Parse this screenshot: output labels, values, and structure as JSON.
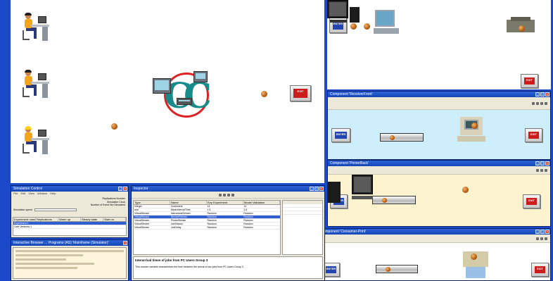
{
  "buttons": {
    "exit": "EXIT",
    "enter": "ENTER"
  },
  "windows": {
    "sub1_title": "Component 'ReceiverFront'",
    "sub2_title": "Component 'PrinterBack'",
    "sub3_title": "Component 'Consumer-Print'",
    "sim_control_title": "Simulation Control",
    "sim_console_title": "Interactive Browser ... Programs (AS) 'Mainframe (Simulator)'",
    "inspect_title": "Inspector"
  },
  "sim_control": {
    "menu": [
      "File",
      "Edit",
      "View",
      "Window",
      "Help"
    ],
    "fields": [
      "Replications Number",
      "Simulation Clock",
      "Number of Event Not Simulated"
    ],
    "animation_speed_label": "Simulation speed",
    "grid_headers": [
      "Experiment name",
      "Replications",
      "Warm up",
      "Steady state",
      "Start on"
    ],
    "grid_rows": [
      "Experiment 1",
      "Cafe Ventures 1"
    ]
  },
  "inspector": {
    "headers": [
      "Type",
      "Name",
      "Key Experiment",
      "Model Validation"
    ],
    "rows": [
      [
        "Integer",
        "Customers",
        "14",
        "14"
      ],
      [
        "real",
        "MeanIntervalTime",
        "1.5",
        "1.5"
      ],
      [
        "VirtualStream",
        "InterarrivalStream",
        "Random",
        "Random"
      ],
      [
        "VirtualStream",
        "ServiceStream",
        "Random",
        "Random"
      ],
      [
        "VirtualStream",
        "PrinterStream",
        "Random",
        "Random"
      ],
      [
        "VirtualStream",
        "JobStream",
        "Random",
        "Random"
      ],
      [
        "VirtualStream",
        "JobDelay",
        "Random",
        "Random"
      ]
    ],
    "desc_title": "Interarrival times of jobs from PC Users Group 3",
    "desc_text": "This random variable characterises the time between the arrival of two jobs from PC Users Group 3."
  },
  "colors": {
    "desktop": "#1b49c9",
    "sub1_bg": "#cfeefb",
    "sub2_bg": "#fdf3cf",
    "sub3_bg": "#ffffff",
    "exit_red": "#cc1c1c",
    "enter_blue": "#2345b0"
  }
}
